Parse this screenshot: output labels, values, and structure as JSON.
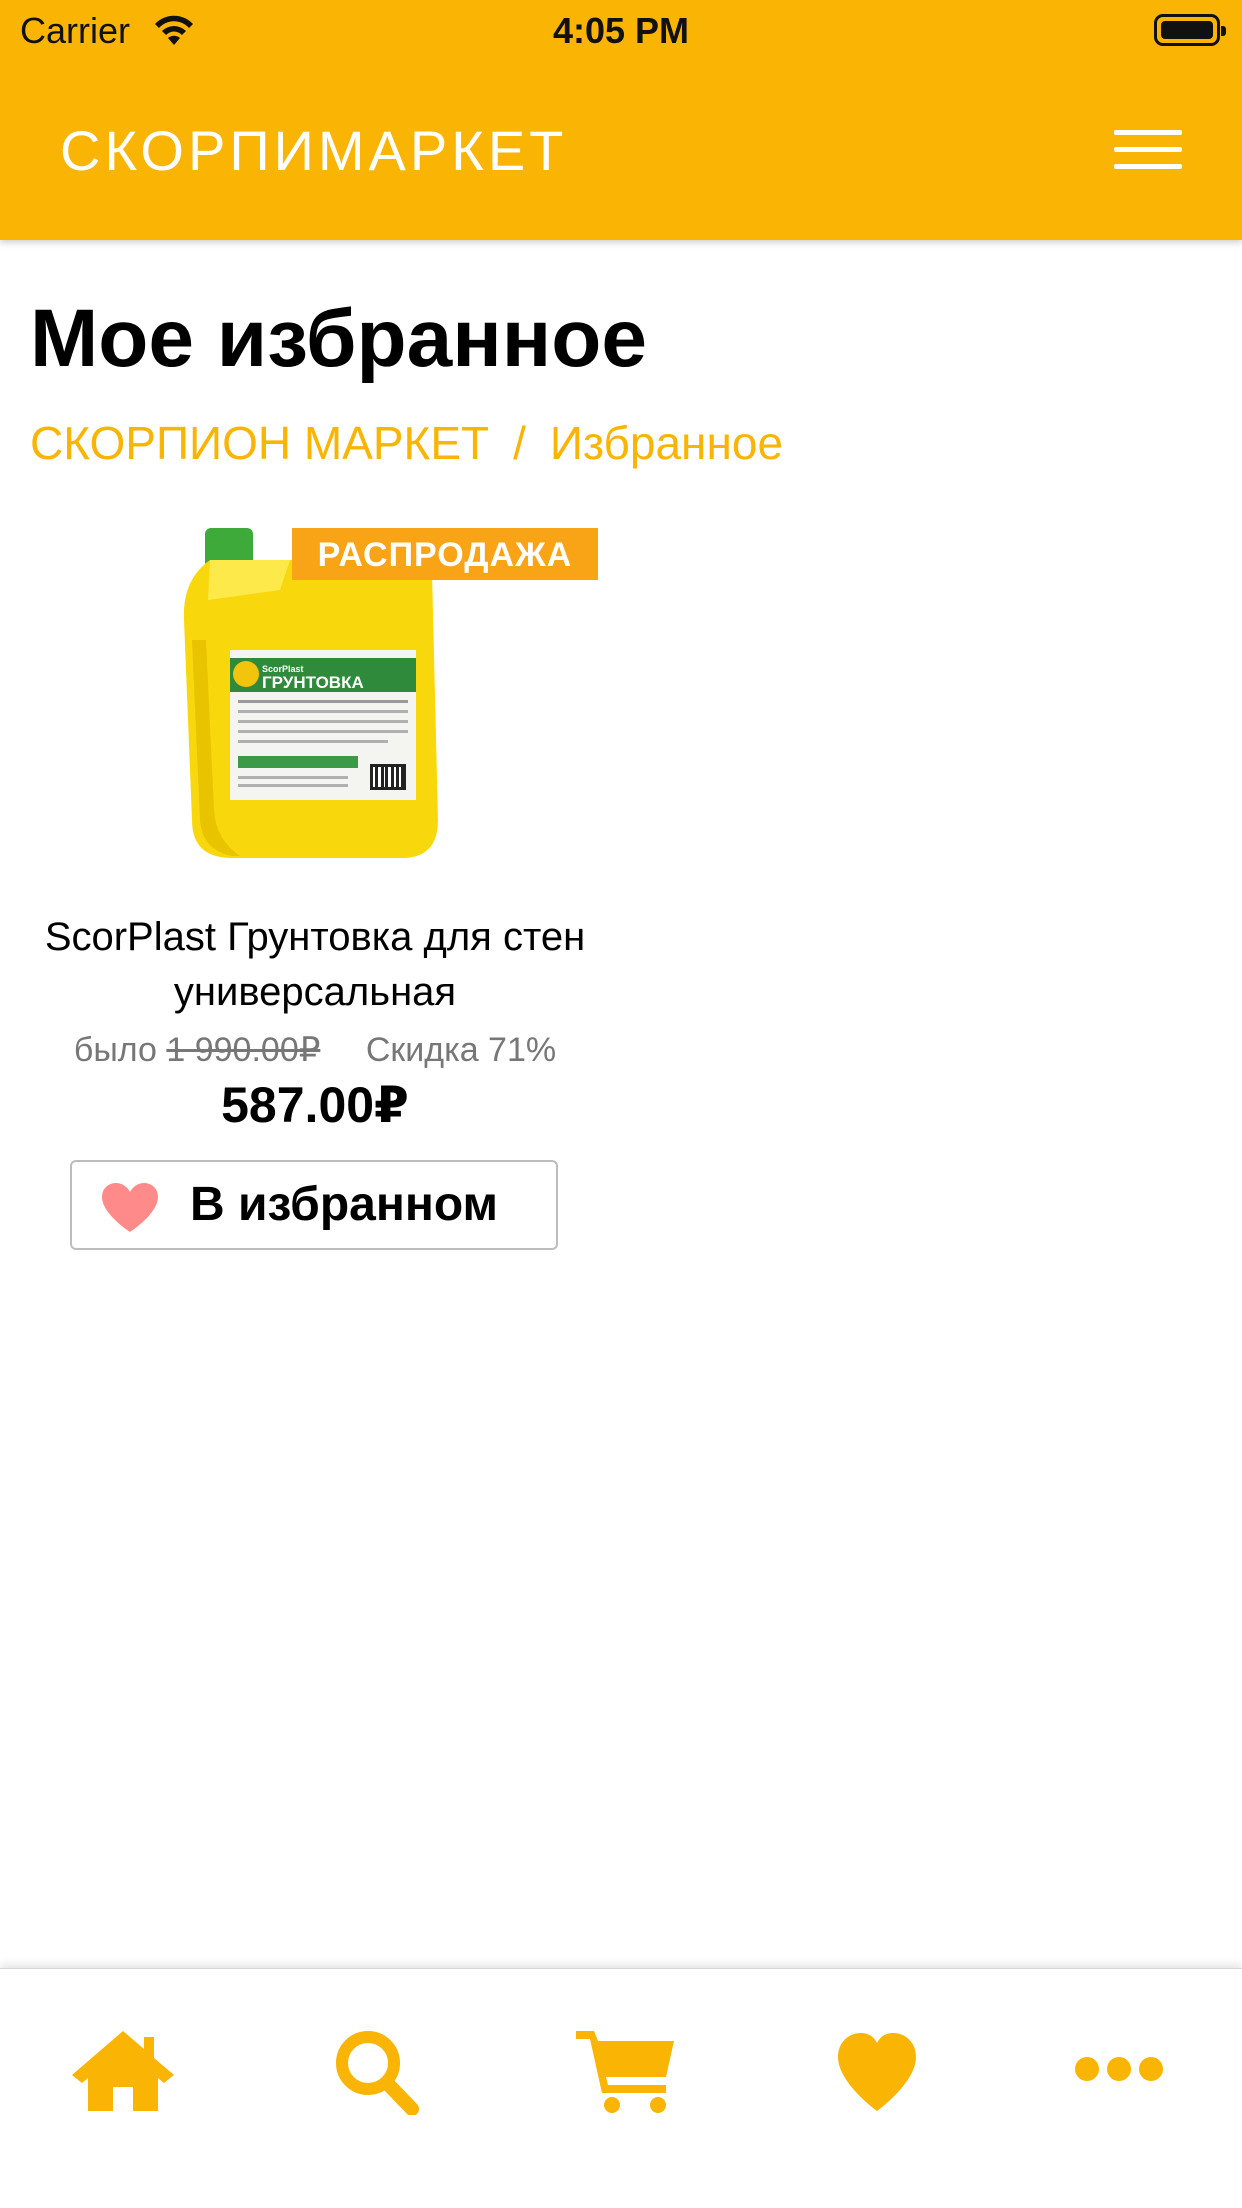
{
  "status_bar": {
    "carrier": "Carrier",
    "time": "4:05 PM",
    "icons": [
      "wifi-icon",
      "battery-icon"
    ]
  },
  "header": {
    "brand": "СКОРПИМАРКЕТ",
    "menu_icon": "hamburger-menu-icon"
  },
  "page": {
    "title": "Мое избранное",
    "breadcrumb": {
      "home": "СКОРПИОН МАРКЕТ",
      "separator": "/",
      "current": "Избранное"
    }
  },
  "products": [
    {
      "badge": "РАСПРОДАЖА",
      "name": "ScorPlast Грунтовка для стен универсальная",
      "old_price_prefix": "было",
      "old_price": "1 990.00₽",
      "discount": "Скидка 71%",
      "price": "587.00₽",
      "favorite_label": "В избранном",
      "label_brand": "ScorPlast",
      "label_product": "ГРУНТОВКА"
    }
  ],
  "tabbar": {
    "tabs": [
      "home-icon",
      "search-icon",
      "cart-icon",
      "heart-icon",
      "more-icon"
    ]
  },
  "colors": {
    "accent": "#f9b404",
    "badge": "#f9a316",
    "heart": "#ff8a8a"
  }
}
